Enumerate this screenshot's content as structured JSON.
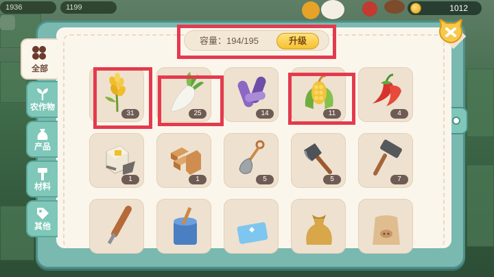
{
  "hud": {
    "left_stat_1": "1936",
    "left_stat_2": "1199",
    "coins": "1012"
  },
  "storage": {
    "capacity_label": "容量：",
    "capacity_value": "194/195",
    "upgrade_label": "升级"
  },
  "tabs": [
    {
      "label": "全部",
      "icon": "grid-icon"
    },
    {
      "label": "农作物",
      "icon": "sprout-icon"
    },
    {
      "label": "产品",
      "icon": "bag-icon"
    },
    {
      "label": "材料",
      "icon": "hammer-icon"
    },
    {
      "label": "其他",
      "icon": "tag-icon"
    }
  ],
  "items": [
    {
      "name": "wheat",
      "count": "31"
    },
    {
      "name": "radish",
      "count": "25"
    },
    {
      "name": "eggplant",
      "count": "14"
    },
    {
      "name": "corn",
      "count": "11"
    },
    {
      "name": "chili-pepper",
      "count": "4"
    },
    {
      "name": "nails",
      "count": "1"
    },
    {
      "name": "planks",
      "count": "1"
    },
    {
      "name": "shovel",
      "count": "5"
    },
    {
      "name": "axe",
      "count": "5"
    },
    {
      "name": "mallet",
      "count": "7"
    },
    {
      "name": "chisel",
      "count": ""
    },
    {
      "name": "paint-bucket",
      "count": ""
    },
    {
      "name": "blue-ticket",
      "count": ""
    },
    {
      "name": "money-bag",
      "count": ""
    },
    {
      "name": "sack",
      "count": ""
    }
  ],
  "colors": {
    "highlight": "#e43a4e",
    "panel_frame": "#79b9b0",
    "panel_bg": "#fbf6ec",
    "slot_bg": "#eee1cf",
    "button_yellow": "#f5c231"
  }
}
